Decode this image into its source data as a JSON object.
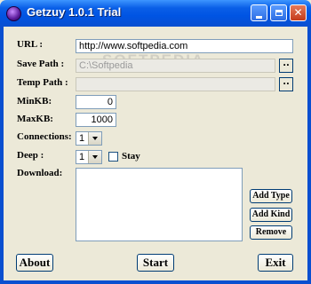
{
  "window": {
    "title": "Getzuy 1.0.1 Trial",
    "watermark": "SOFTPEDIA"
  },
  "form": {
    "url": {
      "label": "URL :",
      "value": "http://www.softpedia.com"
    },
    "save_path": {
      "label": "Save Path :",
      "value": "C:\\Softpedia",
      "browse_label": ".."
    },
    "temp_path": {
      "label": "Temp Path :",
      "value": "",
      "browse_label": ".."
    },
    "min_kb": {
      "label": "MinKB:",
      "value": "0"
    },
    "max_kb": {
      "label": "MaxKB:",
      "value": "1000"
    },
    "connections": {
      "label": "Connections:",
      "value": "1"
    },
    "deep": {
      "label": "Deep :",
      "value": "1",
      "stay_label": "Stay",
      "stay_checked": false
    },
    "download": {
      "label": "Download:",
      "items": []
    }
  },
  "buttons": {
    "add_type": "Add Type",
    "add_kind": "Add Kind",
    "remove": "Remove",
    "about": "About",
    "start": "Start",
    "exit": "Exit"
  },
  "colors": {
    "titlebar": "#0054e3",
    "face": "#ece9d8",
    "close_button": "#c43a1a"
  }
}
